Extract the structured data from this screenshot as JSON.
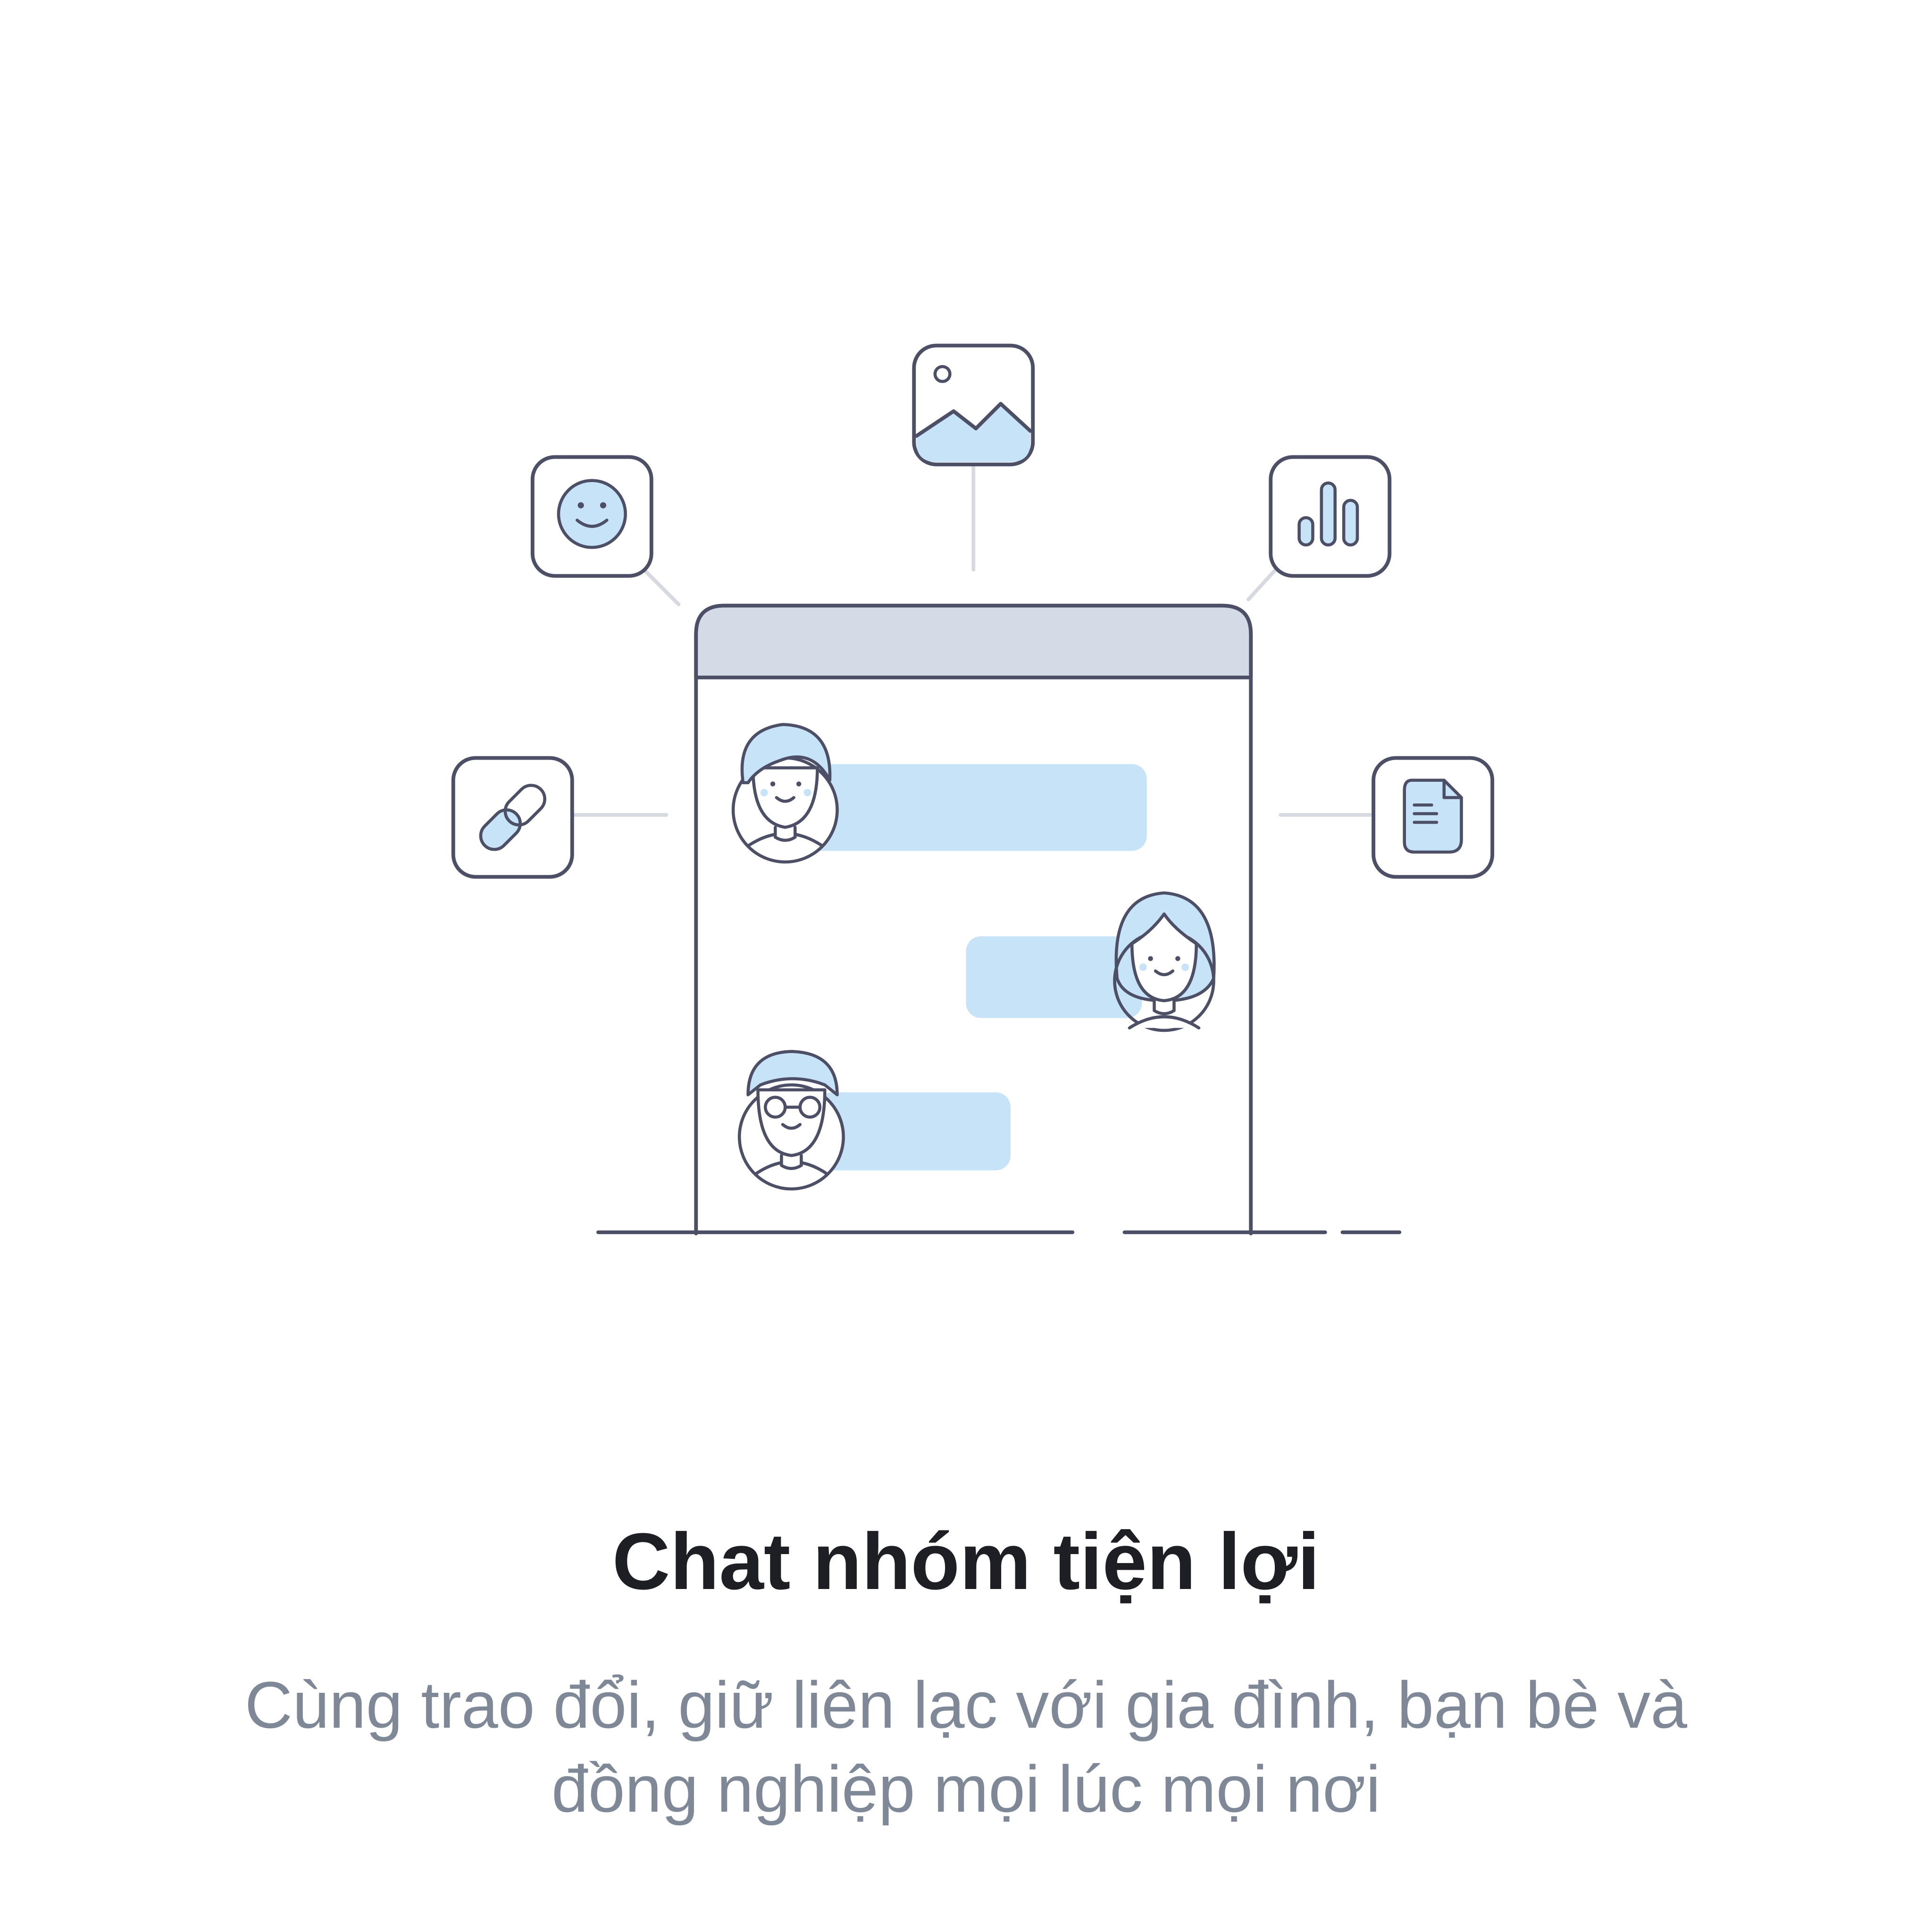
{
  "onboarding": {
    "title": "Chat nhóm tiện lợi",
    "description_lines": [
      "Cùng trao đổi, giữ liên lạc với gia đình, bạn bè và",
      "đồng nghiệp mọi lúc mọi nơi"
    ]
  },
  "illustration": {
    "icons": [
      "image-icon",
      "smiley-icon",
      "bar-chart-icon",
      "link-icon",
      "document-icon"
    ],
    "avatars": [
      "man-avatar",
      "woman-avatar",
      "man-with-glasses-avatar"
    ],
    "colors": {
      "outline": "#4d4f66",
      "accent_fill": "#c7e3f8",
      "header_fill": "#d4dbe7",
      "connector": "#d6d9df",
      "title_text": "#1d1f24",
      "body_text": "#7f8896"
    }
  }
}
